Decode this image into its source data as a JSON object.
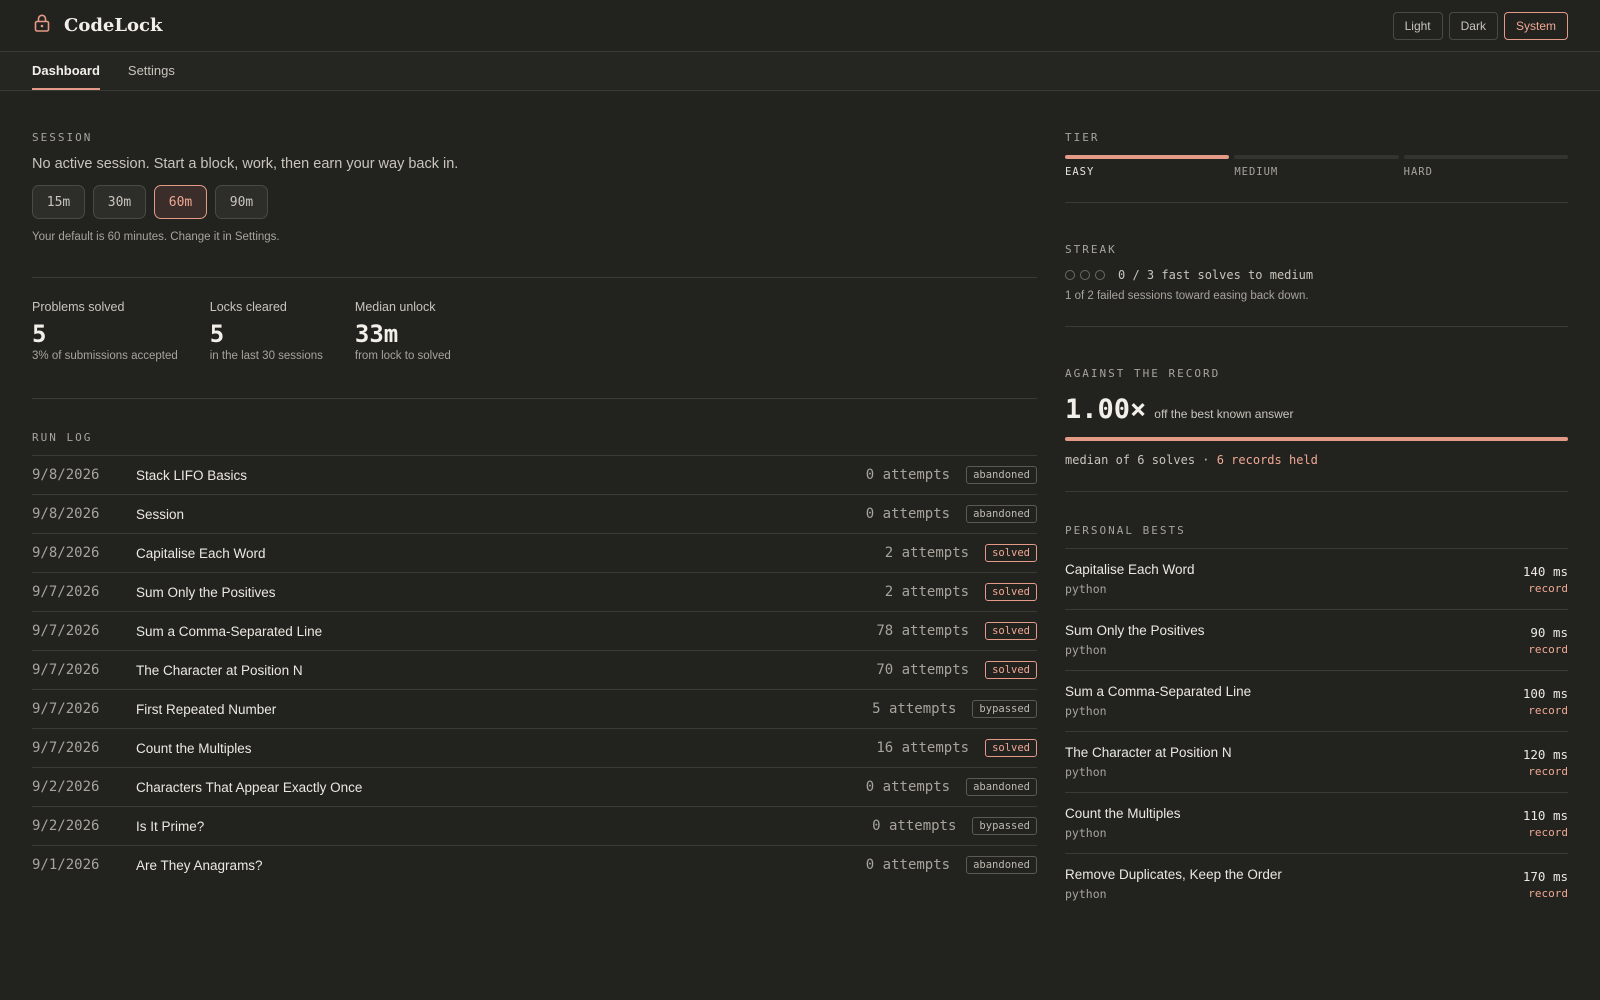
{
  "app": {
    "name": "CodeLock",
    "logo_icon": "lock-icon"
  },
  "theme": {
    "options": [
      "Light",
      "Dark",
      "System"
    ],
    "selected": "System"
  },
  "nav": {
    "tabs": [
      "Dashboard",
      "Settings"
    ],
    "active": "Dashboard"
  },
  "session": {
    "label": "SESSION",
    "message": "No active session. Start a block, work, then earn your way back in.",
    "durations": [
      "15m",
      "30m",
      "60m",
      "90m"
    ],
    "selected": "60m",
    "note": "Your default is 60 minutes. Change it in Settings."
  },
  "stats": [
    {
      "label": "Problems solved",
      "value": "5",
      "sub": "3% of submissions accepted"
    },
    {
      "label": "Locks cleared",
      "value": "5",
      "sub": "in the last 30 sessions"
    },
    {
      "label": "Median unlock",
      "value": "33m",
      "sub": "from lock to solved"
    }
  ],
  "run_log": {
    "label": "RUN LOG",
    "rows": [
      {
        "date": "9/8/2026",
        "title": "Stack LIFO Basics",
        "attempts": "0 attempts",
        "status": "abandoned"
      },
      {
        "date": "9/8/2026",
        "title": "Session",
        "attempts": "0 attempts",
        "status": "abandoned"
      },
      {
        "date": "9/8/2026",
        "title": "Capitalise Each Word",
        "attempts": "2 attempts",
        "status": "solved"
      },
      {
        "date": "9/7/2026",
        "title": "Sum Only the Positives",
        "attempts": "2 attempts",
        "status": "solved"
      },
      {
        "date": "9/7/2026",
        "title": "Sum a Comma-Separated Line",
        "attempts": "78 attempts",
        "status": "solved"
      },
      {
        "date": "9/7/2026",
        "title": "The Character at Position N",
        "attempts": "70 attempts",
        "status": "solved"
      },
      {
        "date": "9/7/2026",
        "title": "First Repeated Number",
        "attempts": "5 attempts",
        "status": "bypassed"
      },
      {
        "date": "9/7/2026",
        "title": "Count the Multiples",
        "attempts": "16 attempts",
        "status": "solved"
      },
      {
        "date": "9/2/2026",
        "title": "Characters That Appear Exactly Once",
        "attempts": "0 attempts",
        "status": "abandoned"
      },
      {
        "date": "9/2/2026",
        "title": "Is It Prime?",
        "attempts": "0 attempts",
        "status": "bypassed"
      },
      {
        "date": "9/1/2026",
        "title": "Are They Anagrams?",
        "attempts": "0 attempts",
        "status": "abandoned"
      }
    ]
  },
  "tier": {
    "label": "TIER",
    "levels": [
      "EASY",
      "MEDIUM",
      "HARD"
    ],
    "current": "EASY"
  },
  "streak": {
    "label": "STREAK",
    "progress": "0 / 3 fast solves to medium",
    "filled": 0,
    "total": 3,
    "sub": "1 of 2 failed sessions toward easing back down."
  },
  "record": {
    "label": "AGAINST THE RECORD",
    "value": "1.00×",
    "sub": "off the best known answer",
    "bar_fraction": 1.0,
    "meta_prefix": "median of 6 solves · ",
    "meta_highlight": "6 records held"
  },
  "personal_bests": {
    "label": "PERSONAL BESTS",
    "rows": [
      {
        "title": "Capitalise Each Word",
        "lang": "python",
        "time": "140 ms",
        "tag": "record"
      },
      {
        "title": "Sum Only the Positives",
        "lang": "python",
        "time": "90 ms",
        "tag": "record"
      },
      {
        "title": "Sum a Comma-Separated Line",
        "lang": "python",
        "time": "100 ms",
        "tag": "record"
      },
      {
        "title": "The Character at Position N",
        "lang": "python",
        "time": "120 ms",
        "tag": "record"
      },
      {
        "title": "Count the Multiples",
        "lang": "python",
        "time": "110 ms",
        "tag": "record"
      },
      {
        "title": "Remove Duplicates, Keep the Order",
        "lang": "python",
        "time": "170 ms",
        "tag": "record"
      }
    ]
  },
  "colors": {
    "background": "#22221f",
    "accent": "#e39a87",
    "border": "#3a3a36"
  }
}
